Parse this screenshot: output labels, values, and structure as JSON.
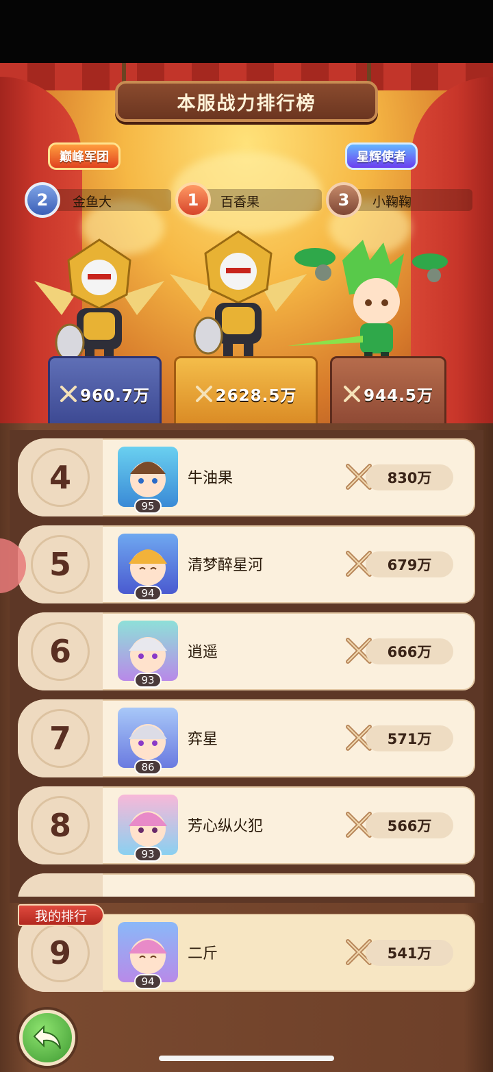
{
  "title": "本服战力排行榜",
  "badges": {
    "left": "巅峰军团",
    "right": "星辉使者"
  },
  "podium": [
    {
      "rank": "2",
      "name": "金鱼大",
      "power": "960.7万"
    },
    {
      "rank": "1",
      "name": "百香果",
      "power": "2628.5万"
    },
    {
      "rank": "3",
      "name": "小鞠鞠",
      "power": "944.5万"
    }
  ],
  "rows": [
    {
      "rank": "4",
      "name": "牛油果",
      "level": "95",
      "power": "830万"
    },
    {
      "rank": "5",
      "name": "清梦醉星河",
      "level": "94",
      "power": "679万"
    },
    {
      "rank": "6",
      "name": "逍遥",
      "level": "93",
      "power": "666万"
    },
    {
      "rank": "7",
      "name": "弈星",
      "level": "86",
      "power": "571万"
    },
    {
      "rank": "8",
      "name": "芳心纵火犯",
      "level": "93",
      "power": "566万"
    }
  ],
  "my_rank": {
    "tag": "我的排行",
    "rank": "9",
    "name": "二斤",
    "level": "94",
    "power": "541万"
  },
  "colors": {
    "accent": "#5a2f22",
    "board": "#6e4029",
    "row": "#fbf0dd"
  },
  "icons": {
    "back": "back-arrow-icon",
    "power": "crossed-swords-icon"
  }
}
